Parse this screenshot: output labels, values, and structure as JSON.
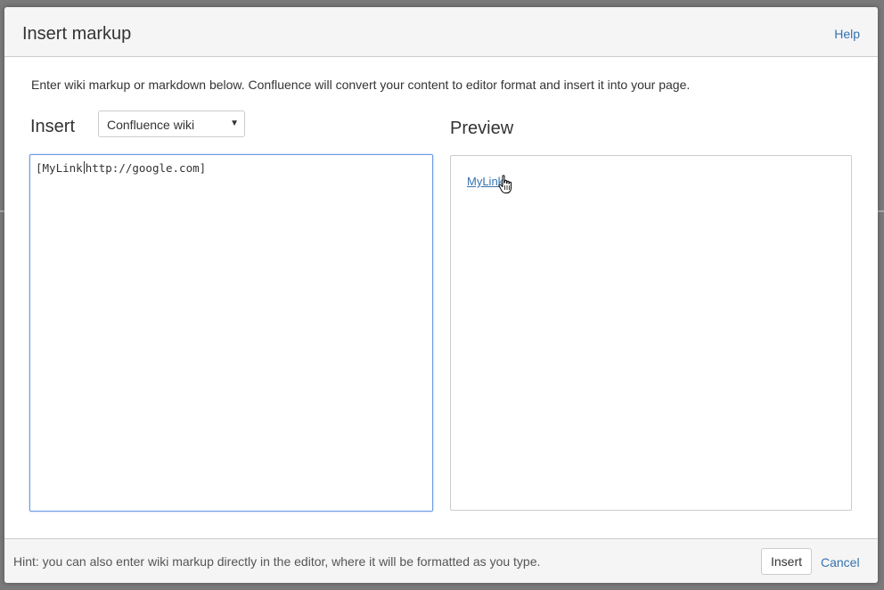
{
  "dialog": {
    "title": "Insert markup",
    "help_label": "Help",
    "description": "Enter wiki markup or markdown below. Confluence will convert your content to editor format and insert it into your page."
  },
  "insert": {
    "label": "Insert",
    "format_selected": "Confluence wiki",
    "textarea_value_before_caret": "[MyLink",
    "textarea_value_after_caret": "http://google.com]"
  },
  "preview": {
    "label": "Preview",
    "link_text": "MyLink"
  },
  "footer": {
    "hint": "Hint: you can also enter wiki markup directly in the editor, where it will be formatted as you type.",
    "insert_button": "Insert",
    "cancel_label": "Cancel"
  },
  "icons": {
    "select_arrow": "chevron-down-icon",
    "pointer": "hand-cursor-icon"
  },
  "colors": {
    "link": "#3572b0",
    "focus_border": "#6b9be0",
    "header_bg": "#f5f5f5"
  }
}
